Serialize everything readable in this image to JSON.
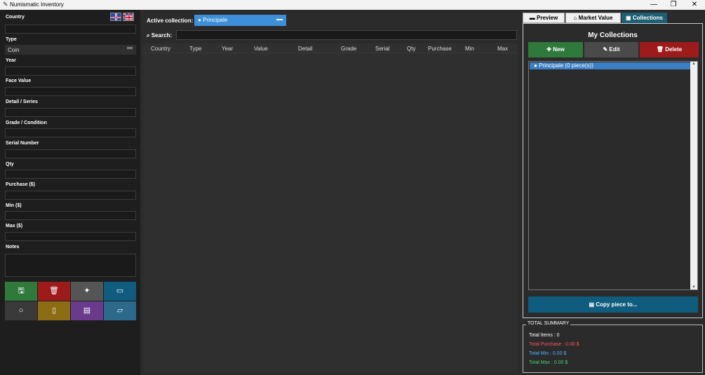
{
  "window": {
    "title": "Numismatic Inventory",
    "minimize": "—",
    "restore": "❐",
    "close": "✕"
  },
  "form": {
    "country_label": "Country",
    "type_label": "Type",
    "type_value": "Coin",
    "year_label": "Year",
    "face_value_label": "Face Value",
    "detail_label": "Detail / Series",
    "grade_label": "Grade / Condition",
    "serial_label": "Serial Number",
    "qty_label": "Qty",
    "purchase_label": "Purchase ($)",
    "min_label": "Min ($)",
    "max_label": "Max ($)",
    "notes_label": "Notes"
  },
  "languages": [
    "fr-flag-icon",
    "uk-flag-icon"
  ],
  "action_buttons": [
    {
      "icon": "save-icon",
      "color": "#2f7a3b"
    },
    {
      "icon": "delete-icon",
      "color": "#9e1b1b"
    },
    {
      "icon": "clear-icon",
      "color": "#555555"
    },
    {
      "icon": "card-icon",
      "color": "#0f5c7e"
    },
    {
      "icon": "refresh-icon",
      "color": "#3a3a3a"
    },
    {
      "icon": "document-icon",
      "color": "#8c6d14"
    },
    {
      "icon": "report-icon",
      "color": "#6a3a8c"
    },
    {
      "icon": "folder-icon",
      "color": "#2c6a8c"
    }
  ],
  "collection": {
    "label": "Active collection:",
    "selected": "Principale"
  },
  "search": {
    "label": "Search:",
    "value": ""
  },
  "table": {
    "columns": [
      "Country",
      "Type",
      "Year",
      "Value",
      "Detail",
      "Grade",
      "Serial",
      "Qty",
      "Purchase",
      "Min",
      "Max"
    ]
  },
  "tabs": [
    {
      "label": "Preview",
      "icon": "preview-icon"
    },
    {
      "label": "Market Value",
      "icon": "market-icon"
    },
    {
      "label": "Collections",
      "icon": "collections-icon"
    }
  ],
  "collections_panel": {
    "title": "My Collections",
    "new_label": "New",
    "edit_label": "Edit",
    "delete_label": "Delete",
    "items": [
      "Principale   (0 piece(s))"
    ],
    "copy_label": "Copy piece to..."
  },
  "summary": {
    "title": "TOTAL SUMMARY",
    "total_items": "Total Items : 0",
    "total_purchase": "Total Purchase : 0.00 $",
    "total_min": "Total Min   : 0.00 $",
    "total_max": "Total Max   : 0.00 $",
    "colors": {
      "items": "#ffffff",
      "purchase": "#ff5555",
      "min": "#4fb0ff",
      "max": "#44d36b"
    }
  },
  "colors": {
    "accent_blue": "#3c8fd8",
    "new_green": "#2f7a3b",
    "delete_red": "#9e1b1b",
    "teal": "#0f5c7e"
  }
}
